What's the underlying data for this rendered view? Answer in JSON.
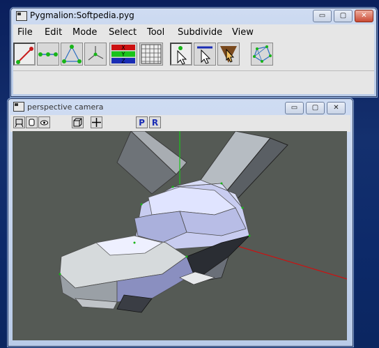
{
  "main_window": {
    "title": "Pygmalion:Softpedia.pyg",
    "menu": [
      "File",
      "Edit",
      "Mode",
      "Select",
      "Tool",
      "Subdivide",
      "View"
    ],
    "minimize_icon": "▭",
    "maximize_icon": "▢",
    "close_icon": "✕"
  },
  "camera_window": {
    "title": "perspective camera",
    "view_labels": {
      "perspective": "P",
      "reset": "R"
    }
  },
  "axis_colors": {
    "x": "#cc1111",
    "y": "#19c419",
    "z": "#1a2db5"
  }
}
